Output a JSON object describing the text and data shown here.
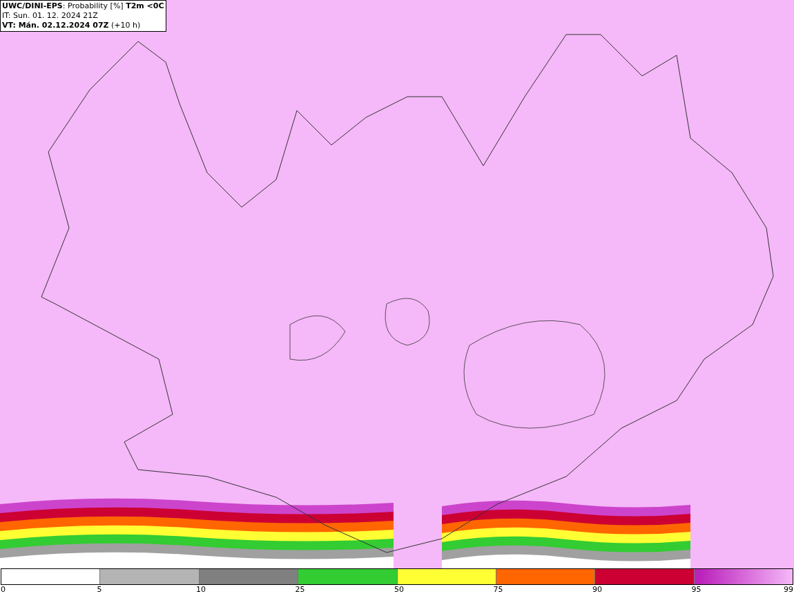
{
  "title_lines": [
    "**UWC/DINI-EPS**: Probability [%] **T2m <0C**",
    "IT: Sun. 01. 12. 2024 21Z",
    "**VT: Mán. 02.12.2024 07Z** (+10 h)"
  ],
  "legend": {
    "segments": [
      {
        "color": "#ffffff"
      },
      {
        "color": "#b4b4b4"
      },
      {
        "color": "#808080"
      },
      {
        "color": "#33cc33"
      },
      {
        "color": "#ffff33"
      },
      {
        "color": "#ff6600"
      },
      {
        "color": "#cc0033"
      },
      {
        "color": "#bb22bb",
        "kind": "gradient"
      }
    ],
    "ticks": [
      "0",
      "5",
      "10",
      "25",
      "50",
      "75",
      "90",
      "95",
      "99"
    ]
  }
}
